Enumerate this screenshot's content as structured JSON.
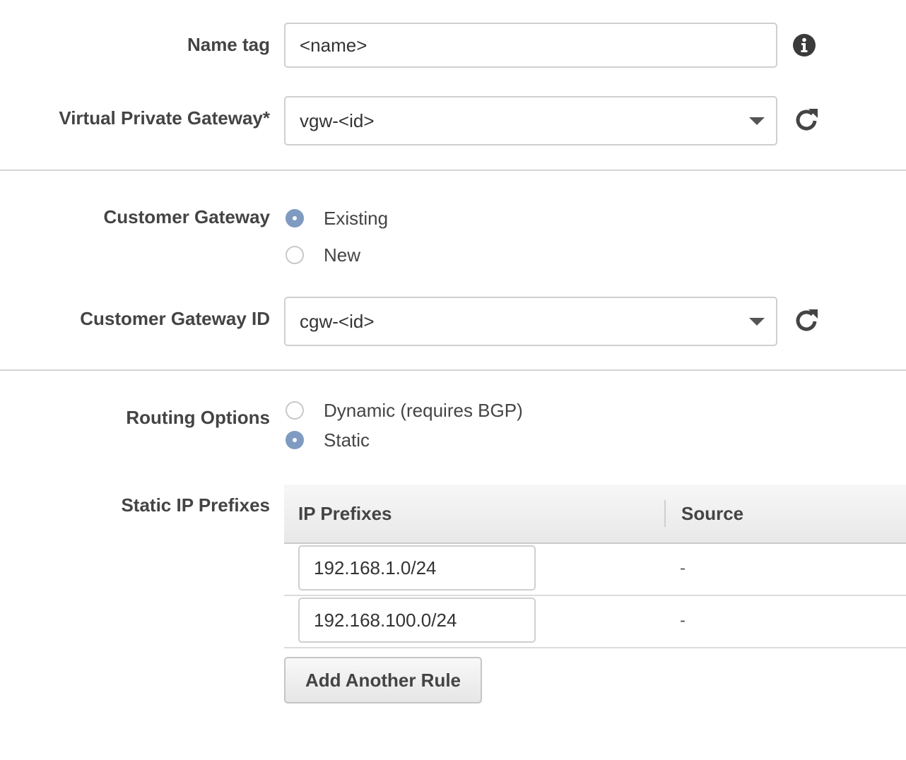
{
  "name_tag": {
    "label": "Name tag",
    "value": "<name>"
  },
  "vpg": {
    "label": "Virtual Private Gateway*",
    "value": "vgw-<id>"
  },
  "customer_gateway": {
    "label": "Customer Gateway",
    "options": [
      {
        "label": "Existing",
        "checked": true
      },
      {
        "label": "New",
        "checked": false
      }
    ]
  },
  "cgw_id": {
    "label": "Customer Gateway ID",
    "value": "cgw-<id>"
  },
  "routing": {
    "label": "Routing Options",
    "options": [
      {
        "label": "Dynamic (requires BGP)",
        "checked": false
      },
      {
        "label": "Static",
        "checked": true
      }
    ]
  },
  "prefixes": {
    "label": "Static IP Prefixes",
    "columns": [
      "IP Prefixes",
      "Source"
    ],
    "rows": [
      {
        "prefix": "192.168.1.0/24",
        "source": "-"
      },
      {
        "prefix": "192.168.100.0/24",
        "source": "-"
      }
    ],
    "add_button": "Add Another Rule"
  },
  "icons": {
    "info": "info-circle-icon",
    "refresh": "refresh-icon"
  },
  "colors": {
    "radio_checked": "#7f9bc1",
    "border": "#cfcfcf",
    "label": "#444444"
  }
}
